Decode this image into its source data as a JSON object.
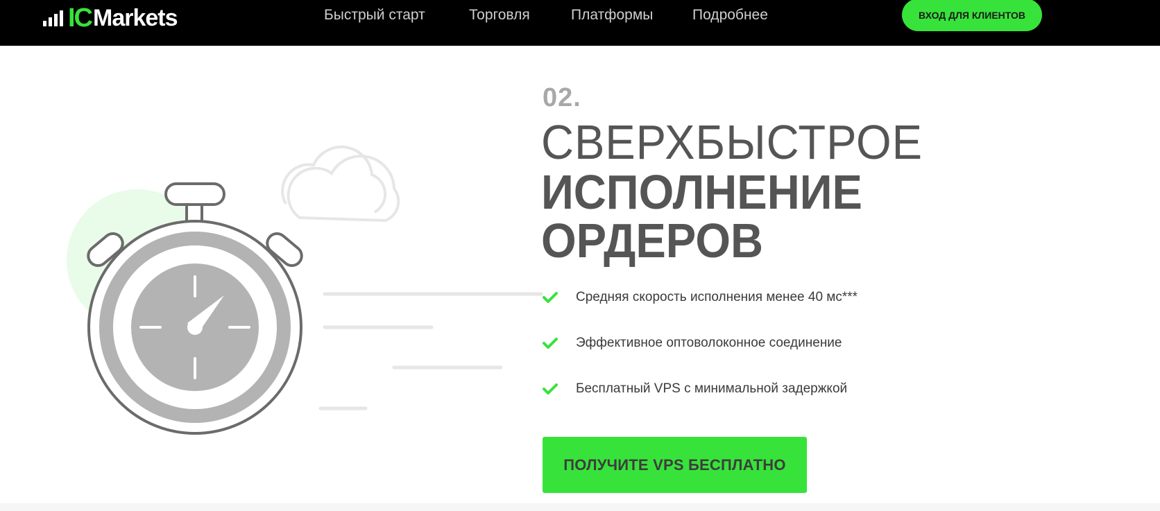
{
  "brand": {
    "logo_ic": "IC",
    "logo_markets": "Markets",
    "accent": "#37e33a"
  },
  "nav": {
    "items": [
      {
        "label": "Быстрый старт"
      },
      {
        "label": "Торговля"
      },
      {
        "label": "Платформы"
      },
      {
        "label": "Подробнее"
      }
    ],
    "login_label": "ВХОД ДЛЯ КЛИЕНТОВ"
  },
  "hero": {
    "step": "02.",
    "title_line1": "СВЕРХБЫСТРОЕ",
    "title_line2": "ИСПОЛНЕНИЕ",
    "title_line3": "ОРДЕРОВ",
    "features": [
      {
        "icon": "check-icon",
        "text": "Средняя скорость исполнения менее 40 мс***"
      },
      {
        "icon": "check-icon",
        "text": "Эффективное оптоволоконное соединение"
      },
      {
        "icon": "check-icon",
        "text": "Бесплатный VPS с минимальной задержкой"
      }
    ],
    "cta_label": "ПОЛУЧИТЕ VPS БЕСПЛАТНО"
  }
}
